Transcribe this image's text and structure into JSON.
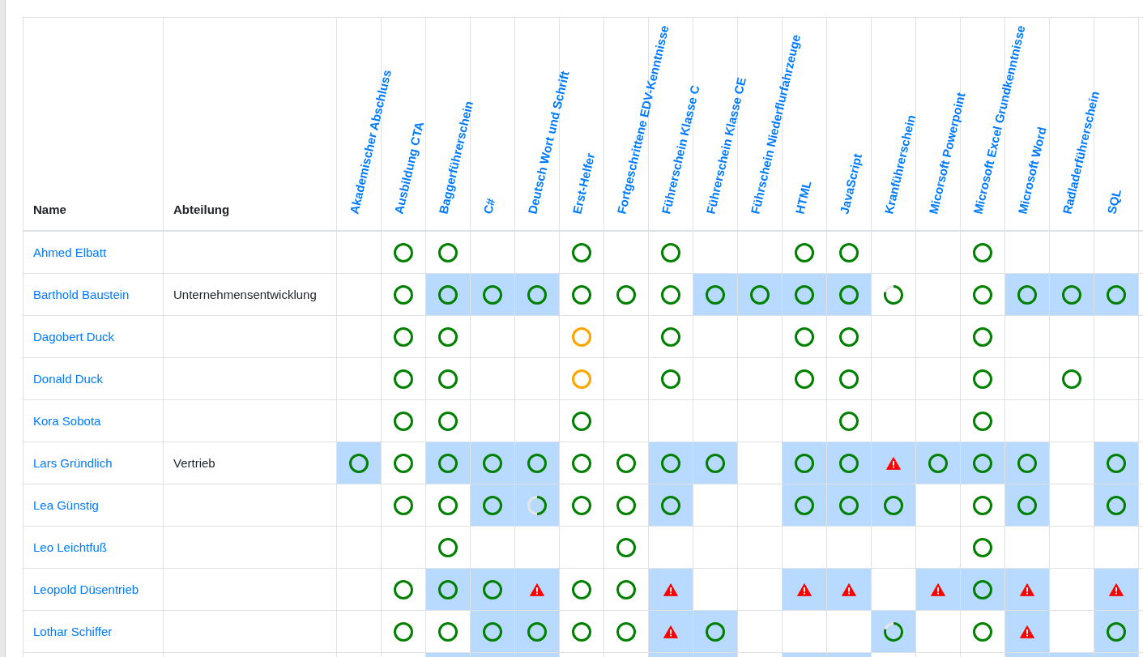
{
  "table": {
    "columns": [
      "Name",
      "Abteilung"
    ],
    "skill_columns": [
      "Akademischer Abschluss",
      "Ausbildung CTA",
      "Baggerführerschein",
      "C#",
      "Deutsch Wort und Schrift",
      "Erst-Helfer",
      "Fortgeschrittene EDV-Kenntnisse",
      "Führerschein Klasse C",
      "Führerschein Klasse CE",
      "Führschein Niederflurfahrzeuge",
      "HTML",
      "JavaScript",
      "Kranführerschein",
      "Micorsoft Powerpoint",
      "Microsoft Excel Grundkenntnisse",
      "Microsoft Word",
      "Radladerführerschein",
      "SQL"
    ],
    "rows": [
      {
        "name": "Ahmed Elbatt",
        "cells": [
          {
            "highlighted": false
          },
          {
            "highlighted": false,
            "kind": "ring",
            "color": "#008000"
          },
          {
            "highlighted": false,
            "kind": "ring",
            "color": "#008000"
          },
          {
            "highlighted": false
          },
          {
            "highlighted": false
          },
          {
            "highlighted": false,
            "kind": "ring",
            "color": "#008000"
          },
          {
            "highlighted": false
          },
          {
            "highlighted": false,
            "kind": "ring",
            "color": "#008000"
          },
          {
            "highlighted": false
          },
          {
            "highlighted": false
          },
          {
            "highlighted": false,
            "kind": "ring",
            "color": "#008000"
          },
          {
            "highlighted": false,
            "kind": "ring",
            "color": "#008000"
          },
          {
            "highlighted": false
          },
          {
            "highlighted": false
          },
          {
            "highlighted": false,
            "kind": "ring",
            "color": "#008000"
          },
          {
            "highlighted": false
          },
          {
            "highlighted": false
          },
          {
            "highlighted": false
          },
          {
            "highlighted": false
          }
        ]
      },
      {
        "name": "Barthold Baustein",
        "department": "Unternehmensentwicklung",
        "cells": [
          {
            "highlighted": false
          },
          {
            "highlighted": false,
            "kind": "ring",
            "color": "#008000"
          },
          {
            "highlighted": true,
            "kind": "ring",
            "color": "#008000"
          },
          {
            "highlighted": true,
            "kind": "ring",
            "color": "#008000"
          },
          {
            "highlighted": true,
            "kind": "ring",
            "color": "#008000"
          },
          {
            "highlighted": false,
            "kind": "ring",
            "color": "#008000"
          },
          {
            "highlighted": false,
            "kind": "ring",
            "color": "#008000"
          },
          {
            "highlighted": false,
            "kind": "ring",
            "color": "#008000"
          },
          {
            "highlighted": true,
            "kind": "ring",
            "color": "#008000"
          },
          {
            "highlighted": true,
            "kind": "ring",
            "color": "#008000"
          },
          {
            "highlighted": true,
            "kind": "ring",
            "color": "#008000"
          },
          {
            "highlighted": true,
            "kind": "ring",
            "color": "#008000"
          },
          {
            "highlighted": false,
            "kind": "progress",
            "level": 0.8
          },
          {
            "highlighted": false
          },
          {
            "highlighted": false,
            "kind": "ring",
            "color": "#008000"
          },
          {
            "highlighted": true,
            "kind": "ring",
            "color": "#008000"
          },
          {
            "highlighted": true,
            "kind": "ring",
            "color": "#008000"
          },
          {
            "highlighted": true,
            "kind": "ring",
            "color": "#008000"
          },
          {
            "highlighted": false
          }
        ]
      },
      {
        "name": "Dagobert Duck",
        "cells": [
          {
            "highlighted": false
          },
          {
            "highlighted": false,
            "kind": "ring",
            "color": "#008000"
          },
          {
            "highlighted": false,
            "kind": "ring",
            "color": "#008000"
          },
          {
            "highlighted": false
          },
          {
            "highlighted": false
          },
          {
            "highlighted": false,
            "kind": "ring",
            "color": "#ffa500"
          },
          {
            "highlighted": false
          },
          {
            "highlighted": false,
            "kind": "ring",
            "color": "#008000"
          },
          {
            "highlighted": false
          },
          {
            "highlighted": false
          },
          {
            "highlighted": false,
            "kind": "ring",
            "color": "#008000"
          },
          {
            "highlighted": false,
            "kind": "ring",
            "color": "#008000"
          },
          {
            "highlighted": false
          },
          {
            "highlighted": false
          },
          {
            "highlighted": false,
            "kind": "ring",
            "color": "#008000"
          },
          {
            "highlighted": false
          },
          {
            "highlighted": false
          },
          {
            "highlighted": false
          },
          {
            "highlighted": false
          }
        ]
      },
      {
        "name": "Donald Duck",
        "cells": [
          {
            "highlighted": false
          },
          {
            "highlighted": false,
            "kind": "ring",
            "color": "#008000"
          },
          {
            "highlighted": false,
            "kind": "ring",
            "color": "#008000"
          },
          {
            "highlighted": false
          },
          {
            "highlighted": false
          },
          {
            "highlighted": false,
            "kind": "ring",
            "color": "#ffa500"
          },
          {
            "highlighted": false
          },
          {
            "highlighted": false,
            "kind": "ring",
            "color": "#008000"
          },
          {
            "highlighted": false
          },
          {
            "highlighted": false
          },
          {
            "highlighted": false,
            "kind": "ring",
            "color": "#008000"
          },
          {
            "highlighted": false,
            "kind": "ring",
            "color": "#008000"
          },
          {
            "highlighted": false
          },
          {
            "highlighted": false
          },
          {
            "highlighted": false,
            "kind": "ring",
            "color": "#008000"
          },
          {
            "highlighted": false
          },
          {
            "highlighted": false,
            "kind": "ring",
            "color": "#008000"
          },
          {
            "highlighted": false
          },
          {
            "highlighted": false
          }
        ]
      },
      {
        "name": "Kora Sobota",
        "cells": [
          {
            "highlighted": false
          },
          {
            "highlighted": false,
            "kind": "ring",
            "color": "#008000"
          },
          {
            "highlighted": false,
            "kind": "ring",
            "color": "#008000"
          },
          {
            "highlighted": false
          },
          {
            "highlighted": false
          },
          {
            "highlighted": false,
            "kind": "ring",
            "color": "#008000"
          },
          {
            "highlighted": false
          },
          {
            "highlighted": false
          },
          {
            "highlighted": false
          },
          {
            "highlighted": false
          },
          {
            "highlighted": false
          },
          {
            "highlighted": false,
            "kind": "ring",
            "color": "#008000"
          },
          {
            "highlighted": false
          },
          {
            "highlighted": false
          },
          {
            "highlighted": false,
            "kind": "ring",
            "color": "#008000"
          },
          {
            "highlighted": false
          },
          {
            "highlighted": false
          },
          {
            "highlighted": false
          },
          {
            "highlighted": false
          }
        ]
      },
      {
        "name": "Lars Gründlich",
        "department": "Vertrieb",
        "cells": [
          {
            "highlighted": true,
            "kind": "ring",
            "color": "#008000"
          },
          {
            "highlighted": false,
            "kind": "ring",
            "color": "#008000"
          },
          {
            "highlighted": true,
            "kind": "ring",
            "color": "#008000"
          },
          {
            "highlighted": true,
            "kind": "ring",
            "color": "#008000"
          },
          {
            "highlighted": true,
            "kind": "ring",
            "color": "#008000"
          },
          {
            "highlighted": false,
            "kind": "ring",
            "color": "#008000"
          },
          {
            "highlighted": false,
            "kind": "ring",
            "color": "#008000"
          },
          {
            "highlighted": true,
            "kind": "ring",
            "color": "#008000"
          },
          {
            "highlighted": true,
            "kind": "ring",
            "color": "#008000"
          },
          {
            "highlighted": false
          },
          {
            "highlighted": true,
            "kind": "ring",
            "color": "#008000"
          },
          {
            "highlighted": true,
            "kind": "ring",
            "color": "#008000"
          },
          {
            "highlighted": true,
            "kind": "alert"
          },
          {
            "highlighted": true,
            "kind": "ring",
            "color": "#008000"
          },
          {
            "highlighted": true,
            "kind": "ring",
            "color": "#008000"
          },
          {
            "highlighted": true,
            "kind": "ring",
            "color": "#008000"
          },
          {
            "highlighted": false
          },
          {
            "highlighted": true,
            "kind": "ring",
            "color": "#008000"
          },
          {
            "highlighted": false
          }
        ]
      },
      {
        "name": "Lea Günstig",
        "cells": [
          {
            "highlighted": false
          },
          {
            "highlighted": false,
            "kind": "ring",
            "color": "#008000"
          },
          {
            "highlighted": false,
            "kind": "ring",
            "color": "#008000"
          },
          {
            "highlighted": true,
            "kind": "ring",
            "color": "#008000"
          },
          {
            "highlighted": true,
            "kind": "progress",
            "level": 0.5
          },
          {
            "highlighted": false,
            "kind": "ring",
            "color": "#008000"
          },
          {
            "highlighted": false,
            "kind": "ring",
            "color": "#008000"
          },
          {
            "highlighted": true,
            "kind": "ring",
            "color": "#008000"
          },
          {
            "highlighted": false
          },
          {
            "highlighted": false
          },
          {
            "highlighted": true,
            "kind": "ring",
            "color": "#008000"
          },
          {
            "highlighted": true,
            "kind": "ring",
            "color": "#008000"
          },
          {
            "highlighted": true,
            "kind": "ring",
            "color": "#008000"
          },
          {
            "highlighted": false
          },
          {
            "highlighted": false,
            "kind": "ring",
            "color": "#008000"
          },
          {
            "highlighted": true,
            "kind": "ring",
            "color": "#008000"
          },
          {
            "highlighted": false
          },
          {
            "highlighted": true,
            "kind": "ring",
            "color": "#008000"
          },
          {
            "highlighted": false
          }
        ]
      },
      {
        "name": "Leo Leichtfuß",
        "cells": [
          {
            "highlighted": false
          },
          {
            "highlighted": false
          },
          {
            "highlighted": false,
            "kind": "ring",
            "color": "#008000"
          },
          {
            "highlighted": false
          },
          {
            "highlighted": false
          },
          {
            "highlighted": false
          },
          {
            "highlighted": false,
            "kind": "ring",
            "color": "#008000"
          },
          {
            "highlighted": false
          },
          {
            "highlighted": false
          },
          {
            "highlighted": false
          },
          {
            "highlighted": false
          },
          {
            "highlighted": false
          },
          {
            "highlighted": false
          },
          {
            "highlighted": false
          },
          {
            "highlighted": false,
            "kind": "ring",
            "color": "#008000"
          },
          {
            "highlighted": false
          },
          {
            "highlighted": false
          },
          {
            "highlighted": false
          },
          {
            "highlighted": false
          }
        ]
      },
      {
        "name": "Leopold Düsentrieb",
        "cells": [
          {
            "highlighted": false
          },
          {
            "highlighted": false,
            "kind": "ring",
            "color": "#008000"
          },
          {
            "highlighted": true,
            "kind": "ring",
            "color": "#008000"
          },
          {
            "highlighted": true,
            "kind": "ring",
            "color": "#008000"
          },
          {
            "highlighted": true,
            "kind": "alert"
          },
          {
            "highlighted": false,
            "kind": "ring",
            "color": "#008000"
          },
          {
            "highlighted": false,
            "kind": "ring",
            "color": "#008000"
          },
          {
            "highlighted": true,
            "kind": "alert"
          },
          {
            "highlighted": false
          },
          {
            "highlighted": false
          },
          {
            "highlighted": true,
            "kind": "alert"
          },
          {
            "highlighted": true,
            "kind": "alert"
          },
          {
            "highlighted": false
          },
          {
            "highlighted": true,
            "kind": "alert"
          },
          {
            "highlighted": true,
            "kind": "ring",
            "color": "#008000"
          },
          {
            "highlighted": true,
            "kind": "alert"
          },
          {
            "highlighted": false
          },
          {
            "highlighted": true,
            "kind": "alert"
          },
          {
            "highlighted": false
          }
        ]
      },
      {
        "name": "Lothar Schiffer",
        "cells": [
          {
            "highlighted": false
          },
          {
            "highlighted": false,
            "kind": "ring",
            "color": "#008000"
          },
          {
            "highlighted": false,
            "kind": "ring",
            "color": "#008000"
          },
          {
            "highlighted": true,
            "kind": "ring",
            "color": "#008000"
          },
          {
            "highlighted": true,
            "kind": "ring",
            "color": "#008000"
          },
          {
            "highlighted": false,
            "kind": "ring",
            "color": "#008000"
          },
          {
            "highlighted": false,
            "kind": "ring",
            "color": "#008000"
          },
          {
            "highlighted": true,
            "kind": "alert"
          },
          {
            "highlighted": true,
            "kind": "ring",
            "color": "#008000"
          },
          {
            "highlighted": false
          },
          {
            "highlighted": false
          },
          {
            "highlighted": false
          },
          {
            "highlighted": true,
            "kind": "progress",
            "level": 0.8
          },
          {
            "highlighted": false
          },
          {
            "highlighted": false,
            "kind": "ring",
            "color": "#008000"
          },
          {
            "highlighted": true,
            "kind": "alert"
          },
          {
            "highlighted": false
          },
          {
            "highlighted": true,
            "kind": "ring",
            "color": "#008000"
          },
          {
            "highlighted": false
          }
        ]
      },
      {
        "cells": [
          {
            "highlighted": false
          },
          {
            "highlighted": false
          },
          {
            "highlighted": true
          },
          {
            "highlighted": true
          },
          {
            "highlighted": true
          },
          {
            "highlighted": false
          },
          {
            "highlighted": false
          },
          {
            "highlighted": true
          },
          {
            "highlighted": true
          },
          {
            "highlighted": false
          },
          {
            "highlighted": true
          },
          {
            "highlighted": true
          },
          {
            "highlighted": false
          },
          {
            "highlighted": false
          },
          {
            "highlighted": false
          },
          {
            "highlighted": true
          },
          {
            "highlighted": true
          },
          {
            "highlighted": true
          }
        ]
      }
    ]
  }
}
